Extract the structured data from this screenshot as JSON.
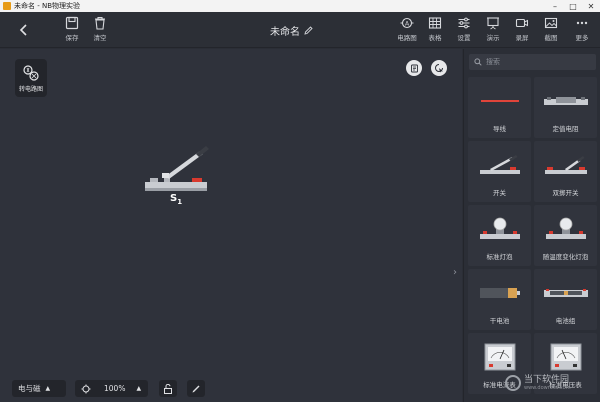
{
  "window": {
    "title": "未命名 - NB物理实验"
  },
  "toolbar": {
    "save": "保存",
    "clear": "清空",
    "doc_title": "未命名",
    "circuit_diagram": "电路图",
    "table": "表格",
    "settings": "设置",
    "demo": "演示",
    "record": "录屏",
    "screenshot": "截图",
    "more": "更多"
  },
  "canvas": {
    "convert_label": "转电路图",
    "component_label": "S",
    "component_subscript": "1"
  },
  "bottom": {
    "mode": "电与磁",
    "zoom": "100%"
  },
  "panel": {
    "search_placeholder": "搜索",
    "items": [
      {
        "label": "导线",
        "icon": "wire-icon"
      },
      {
        "label": "定值电阻",
        "icon": "resistor-icon"
      },
      {
        "label": "开关",
        "icon": "switch-icon"
      },
      {
        "label": "双掷开关",
        "icon": "double-throw-switch-icon"
      },
      {
        "label": "标准灯泡",
        "icon": "bulb-icon"
      },
      {
        "label": "随温度变化灯泡",
        "icon": "temperature-bulb-icon"
      },
      {
        "label": "干电池",
        "icon": "battery-icon"
      },
      {
        "label": "电池组",
        "icon": "battery-pack-icon"
      },
      {
        "label": "标准电流表",
        "icon": "ammeter-icon"
      },
      {
        "label": "标准电压表",
        "icon": "voltmeter-icon"
      }
    ]
  },
  "watermark": {
    "text": "当下软件园",
    "sub": "www.downxia.com"
  }
}
